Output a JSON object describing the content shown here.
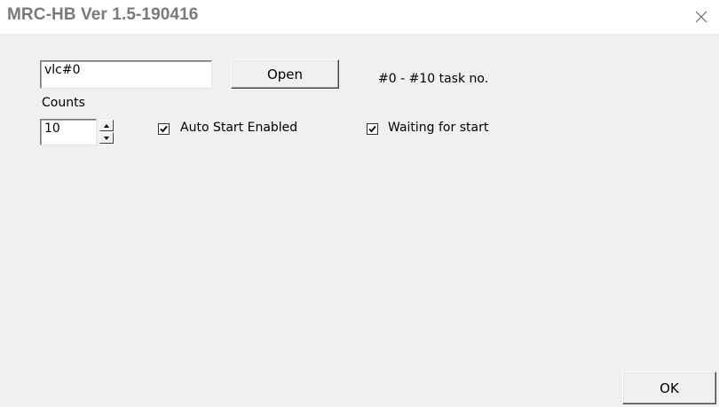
{
  "window": {
    "title": "MRC-HB Ver 1.5-190416",
    "close_glyph": "✕"
  },
  "form": {
    "task_input_value": "vlc#0",
    "open_button_label": "Open",
    "task_range_hint": "#0 - #10 task no.",
    "counts_label": "Counts",
    "counts_value": "10",
    "spin_up_glyph": "▲",
    "spin_down_glyph": "▼",
    "auto_start": {
      "label": "Auto Start Enabled",
      "checked": true
    },
    "waiting": {
      "label": "Waiting for start",
      "checked": true
    },
    "ok_button_label": "OK"
  },
  "colors": {
    "titlebar": "#ffffff",
    "client": "#f0f0f0",
    "title_text": "#7a7a7a"
  }
}
